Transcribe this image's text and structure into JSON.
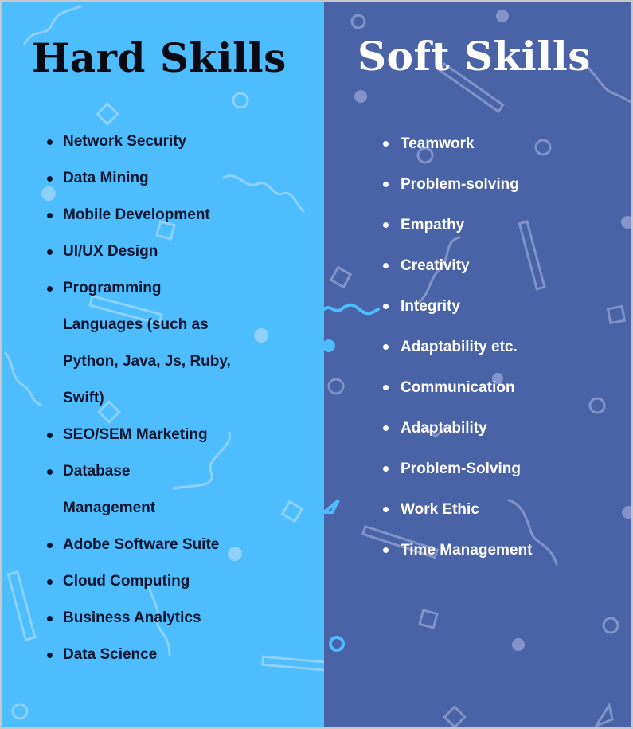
{
  "hard_skills": {
    "title": "Hard Skills",
    "items": [
      "Network Security",
      "Data Mining",
      "Mobile Development",
      "UI/UX Design",
      "Programming",
      "Languages (such as",
      "Python, Java, Js, Ruby,",
      "Swift)",
      "SEO/SEM Marketing",
      "Database",
      "Management",
      "Adobe Software Suite",
      "Cloud Computing",
      "Business Analytics",
      "Data Science"
    ],
    "bulleted": [
      true,
      true,
      true,
      true,
      true,
      false,
      false,
      false,
      true,
      true,
      false,
      true,
      true,
      true,
      true
    ]
  },
  "soft_skills": {
    "title": "Soft Skills",
    "items": [
      "Teamwork",
      "Problem-solving",
      "Empathy",
      "Creativity",
      "Integrity",
      "Adaptability etc.",
      "Communication",
      "Adaptability",
      "Problem-Solving",
      "Work Ethic",
      "Time Management"
    ]
  },
  "colors": {
    "left_background": "#4dbdfd",
    "right_background": "#4a63a6",
    "left_text": "#0c1530",
    "right_text": "#ffffff"
  }
}
